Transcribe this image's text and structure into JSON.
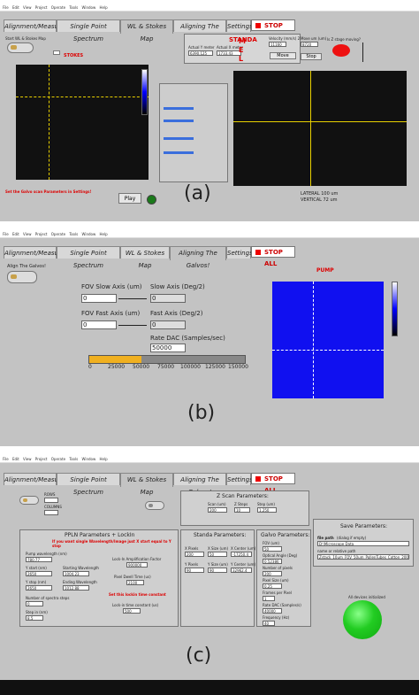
{
  "tabs": [
    "Alignment/Measure",
    "Single Point Spectrum",
    "WL & Stokes Map",
    "Aligning The Galvos!",
    "Settings"
  ],
  "stop_all": "STOP ALL",
  "menu": [
    "File",
    "Edit",
    "View",
    "Project",
    "Operate",
    "Tools",
    "Window",
    "Help"
  ],
  "colors": {
    "panel": "#c3c3c3",
    "plot_bg": "#111111",
    "crosshair": "#e8d000",
    "pump": "#1010f0",
    "accent_red": "#dd0000",
    "led_green": "#22cc22",
    "slider": "#f0b020"
  },
  "a": {
    "letter": "(a)",
    "start_label": "Start WL & Stokes Map",
    "stokes": "STOKES",
    "standa": "STANDA",
    "actual_y": "Actual Y meter",
    "actual_x": "Actual X meter",
    "y_val": "6390.125",
    "x_val": "1733.43",
    "move": "Move",
    "stop": "Stop",
    "velocity": "Velocity (mm/s) 2",
    "vel_val": "11160",
    "move_um": "Move um (um)",
    "move_val": "8720",
    "z_stage": "Is Z stage moving?",
    "play": "Play",
    "lateral": "LATERAL 100 um",
    "vertical": "VERTICAL 72 um",
    "galvo_error": "Set the Galvo scan Parameters in Settings!",
    "m": "M",
    "e": "E",
    "l": "L"
  },
  "b": {
    "letter": "(b)",
    "align": "Align The Galvos!",
    "fov_slow": "FOV Slow Axis (um)",
    "fov_fast": "FOV Fast Axis (um)",
    "slow_axis": "Slow Axis (Deg/2)",
    "fast_axis": "Fast Axis (Deg/2)",
    "slow_val": "0",
    "fast_val": "0",
    "slow_out": "0",
    "fast_out": "0",
    "rate_dac": "Rate DAC (Samples/sec)",
    "rate_val": "50000",
    "slider_ticks": [
      "0",
      "25000",
      "50000",
      "75000",
      "100000",
      "125000",
      "150000"
    ],
    "slider_fraction": 0.333,
    "pump": "PUMP"
  },
  "c": {
    "letter": "(c)",
    "rows": "ROWS",
    "columns": "COLUMNS",
    "z_scan": "Z Scan Parameters:",
    "scan_um": "Scan (um)",
    "z_steps": "Z Steps",
    "step_um": "Step (um)",
    "scan_val": "200",
    "zsteps_val": "10",
    "step_val": "1.250",
    "pplm": "PPLN Parameters + LockIn",
    "ppl_note": "If you want single Wavelength/Image just X start equal to Y stop",
    "standa_params": "Standa Parameters:",
    "galvo_params": "Galvo Parameters:",
    "save_params": "Save Parameters:",
    "file_path": "file path",
    "file_path_note": "(dialog if empty)",
    "file_path_val": "D:\\Microscope Data",
    "name_path": "name or relative path",
    "name_val": "Zstack_10um_FOV_50um_PollenTubes_Cotton_2000Y",
    "devices": "All devices initialized",
    "pump_wl": "Pump wavelength (nm)",
    "pump_wl_val": "780.77",
    "x_start": "Y start (nm)",
    "x_start_val": "2650",
    "starting_wl": "Starting Wavelength",
    "starting_val": "1004.23",
    "x_stop": "Y stop (nm)",
    "x_stop_val": "2650",
    "ending_wl": "Ending Wavelength",
    "ending_val": "1012.88",
    "spectra_steps": "Number of spectra steps",
    "spectra_val": "0",
    "step_in_nm": "Step in (nm)",
    "step_in_val": "8.5",
    "amp_factor": "Lock-In Amplification Factor",
    "amp_val": "900000",
    "pixel_dwell": "Pixel Dwell Time (us)",
    "pixel_val": "2100",
    "lockin_note": "Set this lockin time constant",
    "time_const": "Lock-in time constant (us)",
    "time_val": "500",
    "fov_um": "FOV (um)",
    "fov_val": "50",
    "optical_angle": "Optical Angle (Deg)",
    "optical_val": "0.52386",
    "num_pixels": "Number of pixels",
    "num_pixels_val": "200",
    "pixel_size": "Pixel Size (um)",
    "pixel_size_val": "0.25",
    "x_pixels": "X Pixels",
    "x_size": "X Size (um)",
    "x_center": "X Center (um)",
    "y_pixels": "Y Pixels",
    "y_size": "Y Size (um)",
    "y_center": "Y Center (um)",
    "x_pix_val": "200",
    "x_size_val": "50",
    "x_center_val": "-17250.4",
    "y_pix_val": "90",
    "y_size_val": "90",
    "y_center_val": "32962.4",
    "frames": "Frames per Pixel",
    "frames_val": "1",
    "rate_dac": "Rate DAC (Samples/s)",
    "rate_val": "40000",
    "freq": "Frequency (Hz)",
    "freq_val": "40"
  }
}
